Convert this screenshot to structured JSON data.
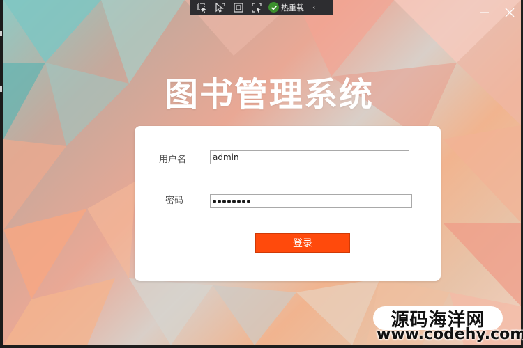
{
  "app": {
    "title": "图书管理系统"
  },
  "dev_toolbar": {
    "hot_reload_label": "热重载",
    "icons": [
      "select-element-icon",
      "pointer-icon",
      "layout-adorner-icon",
      "track-focus-icon",
      "hot-reload-check-icon"
    ]
  },
  "login": {
    "username_label": "用户名",
    "username_value": "admin",
    "password_label": "密码",
    "password_length": 8,
    "submit_label": "登录"
  },
  "watermark": {
    "brand": "源码海洋网",
    "url": "www.codehy.com"
  },
  "colors": {
    "accent": "#ff4a0c",
    "card_bg": "#ffffff",
    "title": "#ffffff",
    "toolbar_bg": "#2d2d30"
  }
}
